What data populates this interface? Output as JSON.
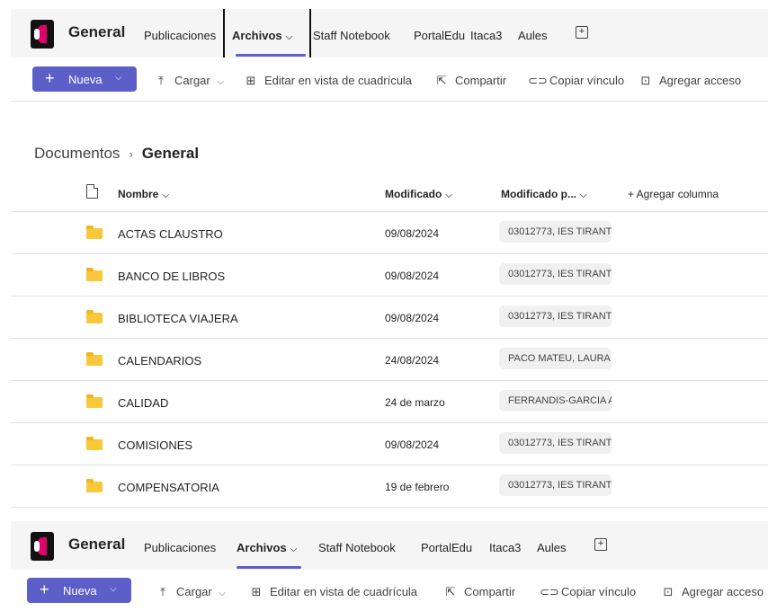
{
  "header": {
    "team_name": "General",
    "tabs": [
      {
        "label": "Publicaciones"
      },
      {
        "label": "Archivos",
        "chevron": "⌵"
      },
      {
        "label": "Staff Notebook"
      },
      {
        "label": "PortalEdu"
      },
      {
        "label": "Itaca3"
      },
      {
        "label": "Aules"
      }
    ],
    "add_tab": "+"
  },
  "commands": {
    "new": {
      "plus": "+",
      "label": "Nueva",
      "chevron": "⌵"
    },
    "upload": {
      "icon": "⤒",
      "label": "Cargar",
      "chevron": "⌵"
    },
    "grid": {
      "icon": "⊞",
      "label": "Editar en vista de cuadrícula"
    },
    "share": {
      "icon": "⇱",
      "label": "Compartir"
    },
    "copy": {
      "icon": "⊂⊃",
      "label": "Copiar vínculo"
    },
    "shortcut": {
      "icon": "⊡",
      "label": "Agregar acceso"
    }
  },
  "breadcrumb": {
    "root": "Documentos",
    "separator": "›",
    "current": "General"
  },
  "columns": {
    "name": "Nombre",
    "modified": "Modificado",
    "modified_by": "Modificado p...",
    "add": "+  Agregar columna",
    "chev": "⌵"
  },
  "files": [
    {
      "name": "ACTAS CLAUSTRO",
      "date": "09/08/2024",
      "by": "03012773, IES TIRANT"
    },
    {
      "name": "BANCO DE LIBROS",
      "date": "09/08/2024",
      "by": "03012773, IES TIRANT"
    },
    {
      "name": "BIBLIOTECA VIAJERA",
      "date": "09/08/2024",
      "by": "03012773, IES TIRANT"
    },
    {
      "name": "CALENDARIOS",
      "date": "24/08/2024",
      "by": "PACO MATEU, LAURA"
    },
    {
      "name": "CALIDAD",
      "date": "24 de marzo",
      "by": "FERRANDIS-GARCIA A"
    },
    {
      "name": "COMISIONES",
      "date": "09/08/2024",
      "by": "03012773, IES TIRANT"
    },
    {
      "name": "COMPENSATORIA",
      "date": "19 de febrero",
      "by": "03012773, IES TIRANT"
    }
  ],
  "icons": {
    "folder": "folder-icon",
    "document": "document-icon"
  },
  "colors": {
    "accent": "#5b5fc7",
    "folder": "#f9c83a"
  }
}
